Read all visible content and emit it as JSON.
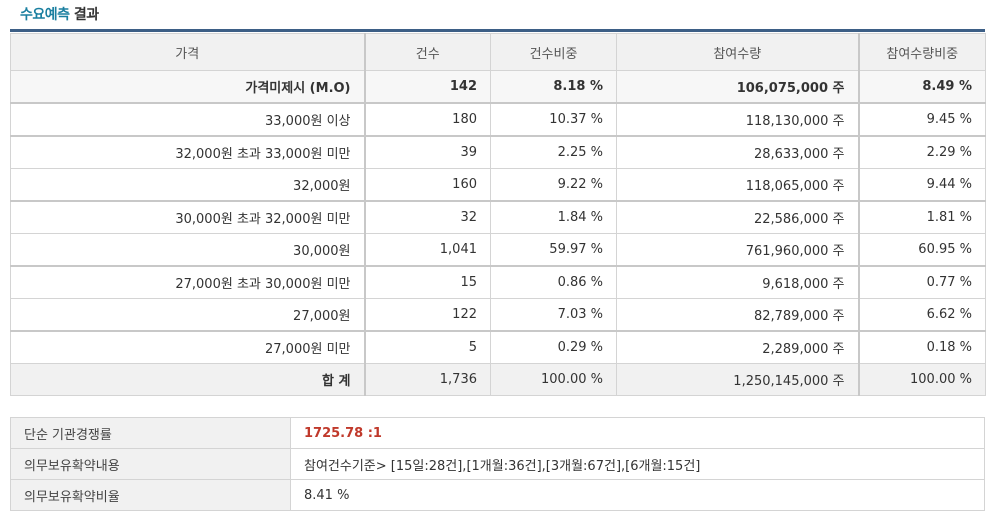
{
  "title": {
    "accent": "수요예측",
    "rest": "결과"
  },
  "columns": [
    "가격",
    "건수",
    "건수비중",
    "참여수량",
    "참여수량비중"
  ],
  "rows": [
    {
      "price": "가격미제시 (M.O)",
      "count": "142",
      "count_ratio": "8.18 %",
      "quantity": "106,075,000 주",
      "qty_ratio": "8.49 %"
    },
    {
      "price": "33,000원 이상",
      "count": "180",
      "count_ratio": "10.37 %",
      "quantity": "118,130,000 주",
      "qty_ratio": "9.45 %"
    },
    {
      "price": "32,000원 초과 33,000원 미만",
      "count": "39",
      "count_ratio": "2.25 %",
      "quantity": "28,633,000 주",
      "qty_ratio": "2.29 %"
    },
    {
      "price": "32,000원",
      "count": "160",
      "count_ratio": "9.22 %",
      "quantity": "118,065,000 주",
      "qty_ratio": "9.44 %"
    },
    {
      "price": "30,000원 초과 32,000원 미만",
      "count": "32",
      "count_ratio": "1.84 %",
      "quantity": "22,586,000 주",
      "qty_ratio": "1.81 %"
    },
    {
      "price": "30,000원",
      "count": "1,041",
      "count_ratio": "59.97 %",
      "quantity": "761,960,000 주",
      "qty_ratio": "60.95 %"
    },
    {
      "price": "27,000원 초과 30,000원 미만",
      "count": "15",
      "count_ratio": "0.86 %",
      "quantity": "9,618,000 주",
      "qty_ratio": "0.77 %"
    },
    {
      "price": "27,000원",
      "count": "122",
      "count_ratio": "7.03 %",
      "quantity": "82,789,000 주",
      "qty_ratio": "6.62 %"
    },
    {
      "price": "27,000원 미만",
      "count": "5",
      "count_ratio": "0.29 %",
      "quantity": "2,289,000 주",
      "qty_ratio": "0.18 %"
    }
  ],
  "total": {
    "label": "합 계",
    "count": "1,736",
    "count_ratio": "100.00 %",
    "quantity": "1,250,145,000 주",
    "qty_ratio": "100.00 %"
  },
  "summary": {
    "competition_label": "단순 기관경쟁률",
    "competition_value": "1725.78 :1",
    "lockup_label": "의무보유확약내용",
    "lockup_value": "참여건수기준> [15일:28건],[1개월:36건],[3개월:67건],[6개월:15건]",
    "lockup_ratio_label": "의무보유확약비율",
    "lockup_ratio_value": "8.41 %"
  },
  "colors": {
    "accent": "#1a7fa0",
    "title_bar": "#3d5f86",
    "highlight_red": "#c0392b"
  }
}
